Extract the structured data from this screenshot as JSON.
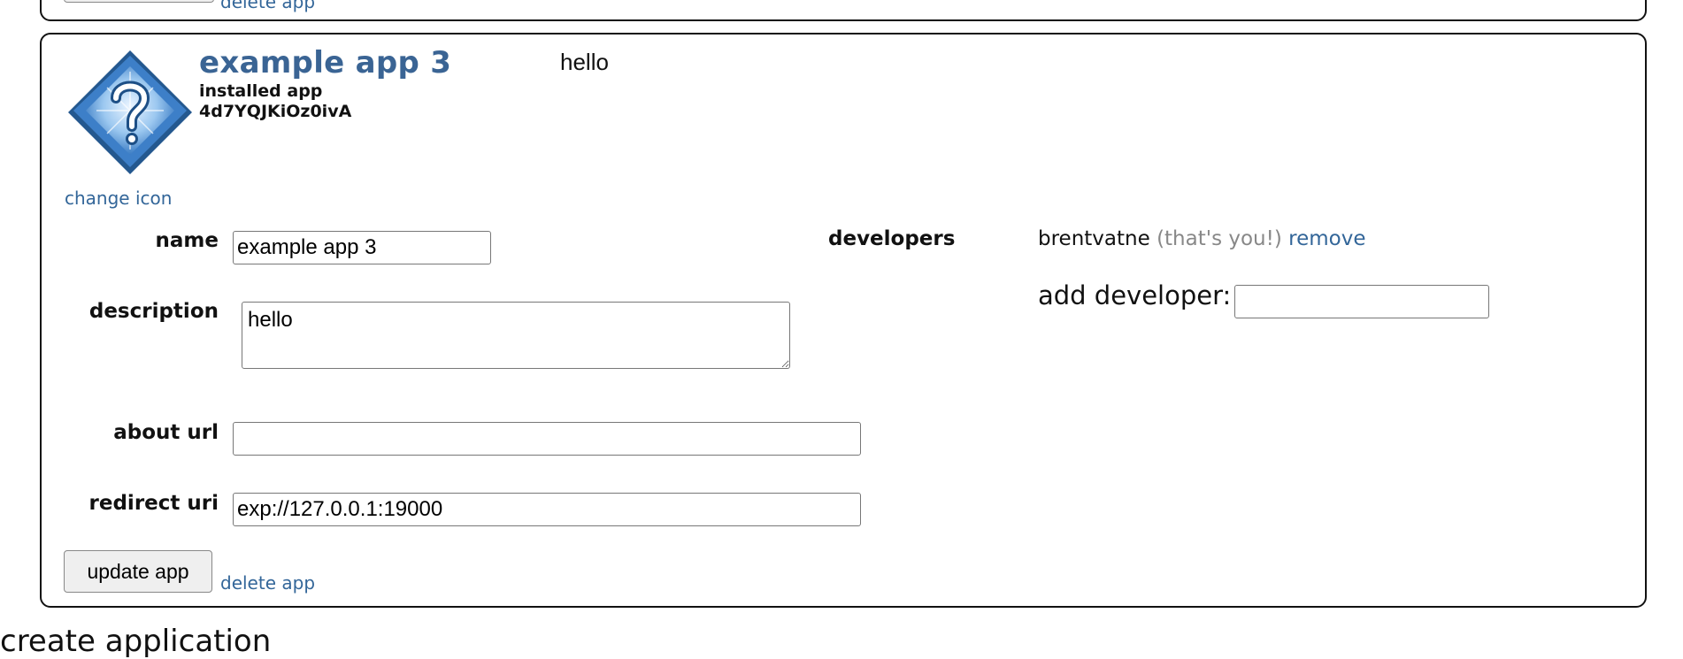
{
  "previous_app": {
    "delete_label": "delete app"
  },
  "app": {
    "title": "example app 3",
    "type": "installed app",
    "id": "4d7YQJKiOz0ivA",
    "description_preview": "hello",
    "change_icon_label": "change icon",
    "icon_name": "question-mark-icon",
    "fields": {
      "name_label": "name",
      "name_value": "example app 3",
      "description_label": "description",
      "description_value": "hello",
      "about_url_label": "about url",
      "about_url_value": "",
      "redirect_uri_label": "redirect uri",
      "redirect_uri_value": "exp://127.0.0.1:19000"
    },
    "developers": {
      "label": "developers",
      "name": "brentvatne",
      "note": "(that's you!)",
      "remove_label": "remove",
      "add_label": "add developer:",
      "add_value": ""
    },
    "update_label": "update app",
    "delete_label": "delete app"
  },
  "create_heading": "create application",
  "colors": {
    "link": "#336699",
    "title": "#3a6494",
    "muted": "#888888",
    "icon_blue": "#2f6db3"
  }
}
